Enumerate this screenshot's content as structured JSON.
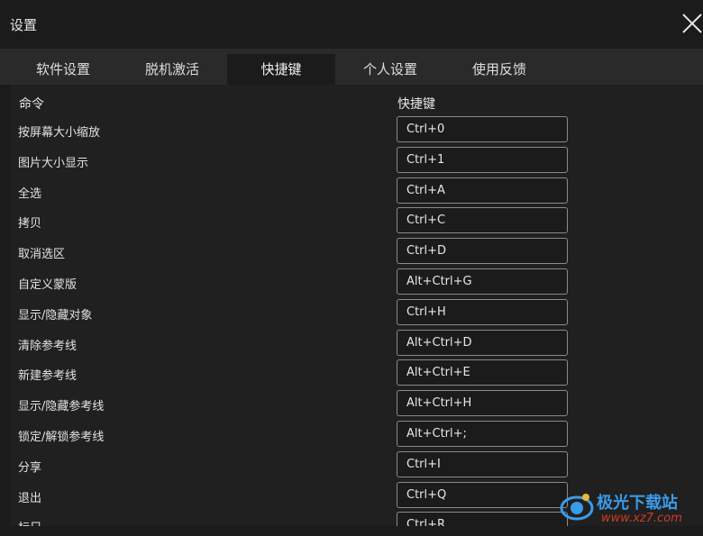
{
  "window": {
    "title": "设置",
    "close_icon": "close-icon"
  },
  "tabs": [
    {
      "label": "软件设置",
      "active": false
    },
    {
      "label": "脱机激活",
      "active": false
    },
    {
      "label": "快捷键",
      "active": true
    },
    {
      "label": "个人设置",
      "active": false
    },
    {
      "label": "使用反馈",
      "active": false
    }
  ],
  "table": {
    "headers": {
      "command": "命令",
      "shortcut": "快捷键"
    },
    "rows": [
      {
        "command": "按屏幕大小缩放",
        "shortcut": "Ctrl+0"
      },
      {
        "command": "图片大小显示",
        "shortcut": "Ctrl+1"
      },
      {
        "command": "全选",
        "shortcut": "Ctrl+A"
      },
      {
        "command": "拷贝",
        "shortcut": "Ctrl+C"
      },
      {
        "command": "取消选区",
        "shortcut": "Ctrl+D"
      },
      {
        "command": "自定义蒙版",
        "shortcut": "Alt+Ctrl+G"
      },
      {
        "command": "显示/隐藏对象",
        "shortcut": "Ctrl+H"
      },
      {
        "command": "清除参考线",
        "shortcut": "Alt+Ctrl+D"
      },
      {
        "command": "新建参考线",
        "shortcut": "Alt+Ctrl+E"
      },
      {
        "command": "显示/隐藏参考线",
        "shortcut": "Alt+Ctrl+H"
      },
      {
        "command": "锁定/解锁参考线",
        "shortcut": "Alt+Ctrl+;"
      },
      {
        "command": "分享",
        "shortcut": "Ctrl+I"
      },
      {
        "command": "退出",
        "shortcut": "Ctrl+Q"
      },
      {
        "command": "标尺",
        "shortcut": "Ctrl+R"
      }
    ]
  },
  "watermark": {
    "name": "极光下载站",
    "url": "www.xz7.com"
  },
  "colors": {
    "background": "#1b1b1b",
    "tabbar": "#2a2a2a",
    "panel": "#202020",
    "keybox_border": "#8a8a8a",
    "watermark_blue": "#3a9be8",
    "watermark_red": "#cf3b2a"
  }
}
